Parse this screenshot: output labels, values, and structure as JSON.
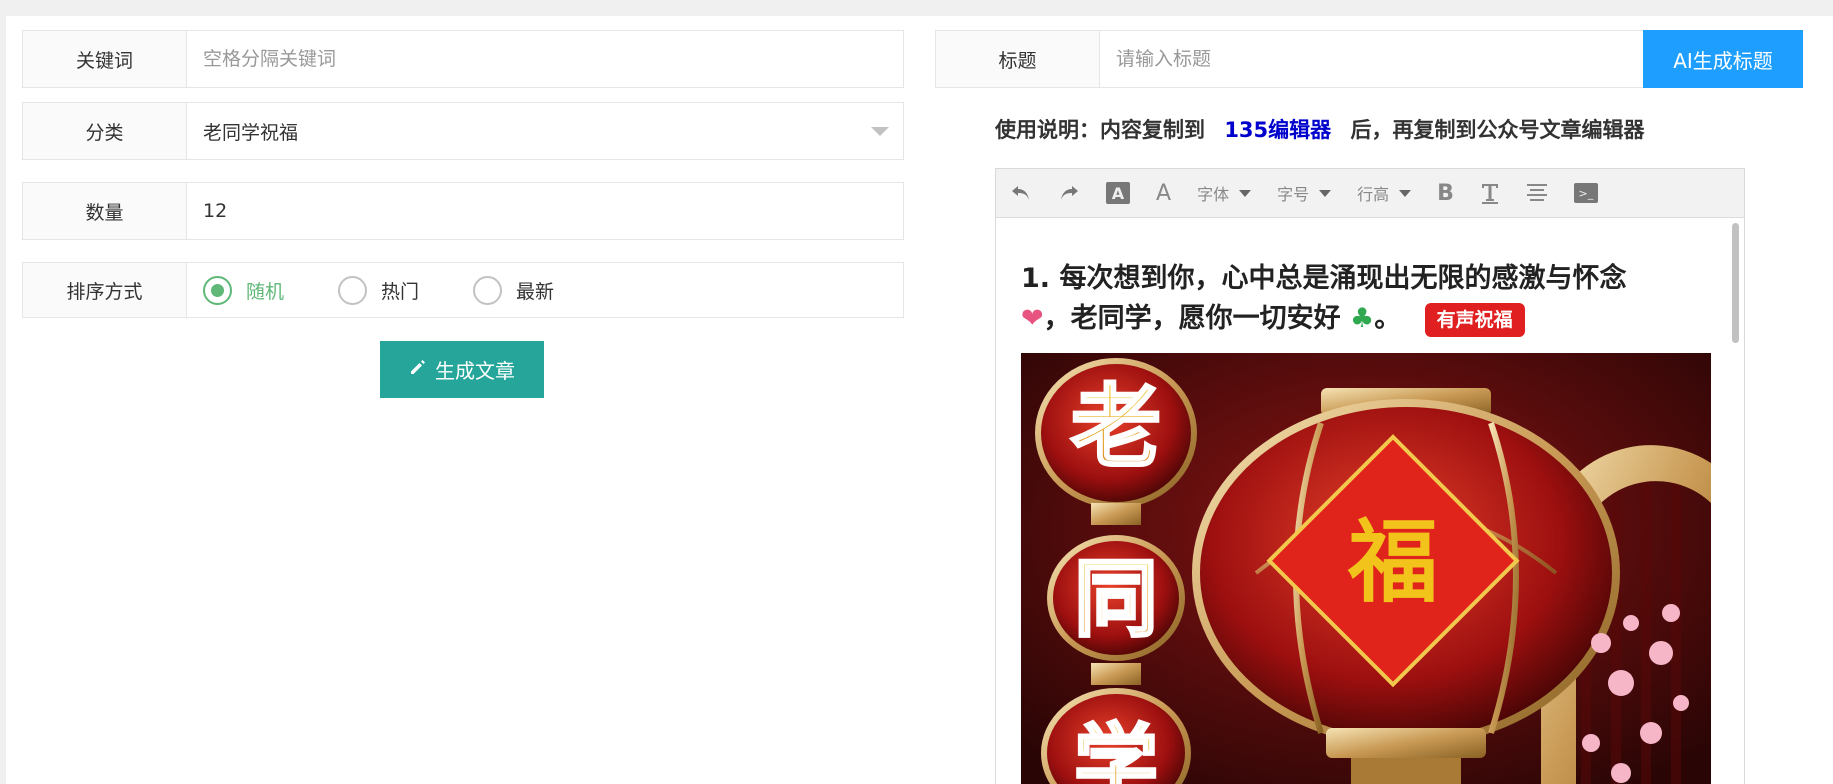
{
  "form": {
    "keyword": {
      "label": "关键词",
      "placeholder": "空格分隔关键词"
    },
    "category": {
      "label": "分类",
      "value": "老同学祝福"
    },
    "count": {
      "label": "数量",
      "value": "12"
    },
    "sort": {
      "label": "排序方式",
      "options": [
        "随机",
        "热门",
        "最新"
      ],
      "selected": "随机"
    },
    "generate_button": "生成文章"
  },
  "title_field": {
    "label": "标题",
    "placeholder": "请输入标题",
    "ai_button": "AI生成标题"
  },
  "usage": {
    "prefix": "使用说明：内容复制到",
    "link": "135编辑器",
    "suffix": "后，再复制到公众号文章编辑器"
  },
  "toolbar": {
    "font_family": "字体",
    "font_size": "字号",
    "line_height": "行高",
    "icons": [
      "undo-icon",
      "redo-icon",
      "background-color-icon",
      "font-color-icon",
      "bold-icon",
      "clear-format-icon",
      "align-icon",
      "source-code-icon"
    ]
  },
  "article": {
    "heading_part1": "1. 每次想到你，心中总是涌现出无限的感激与怀念",
    "heading_part2": "，老同学，愿你一切安好",
    "heading_end": "。",
    "badge": "有声祝福",
    "poster_chars": [
      "老",
      "同",
      "学"
    ],
    "poster_fu": "福"
  },
  "colors": {
    "accent_green": "#5fb878",
    "teal_button": "#26a69a",
    "blue_button": "#1e9fff",
    "link_blue": "#0000cc",
    "badge_red": "#e02020"
  }
}
